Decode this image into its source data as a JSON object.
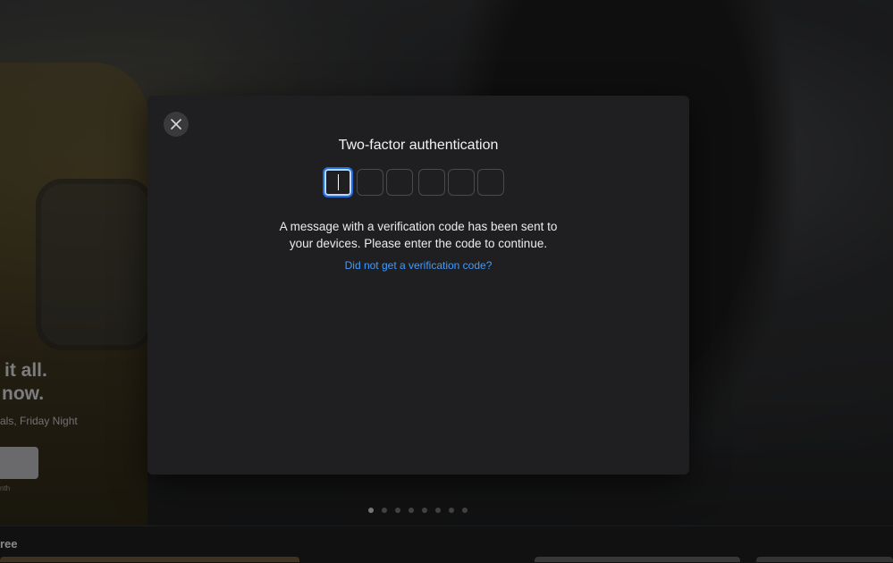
{
  "background": {
    "hero_lines": [
      "it all.",
      "now."
    ],
    "hero_sub": "als, Friday Night",
    "hero_fine": "nth",
    "bottom_label": "ree",
    "carousel_dots": 8,
    "carousel_active_index": 0
  },
  "modal": {
    "close_icon": "close-icon",
    "title": "Two-factor authentication",
    "code_boxes": [
      "",
      "",
      "",
      "",
      "",
      ""
    ],
    "message_line1": "A message with a verification code has been sent to",
    "message_line2": "your devices. Please enter the code to continue.",
    "help_link": "Did not get a verification code?"
  },
  "colors": {
    "accent": "#3f9bff",
    "focus_ring": "#1d6fe0",
    "modal_bg": "#1f1f21"
  }
}
